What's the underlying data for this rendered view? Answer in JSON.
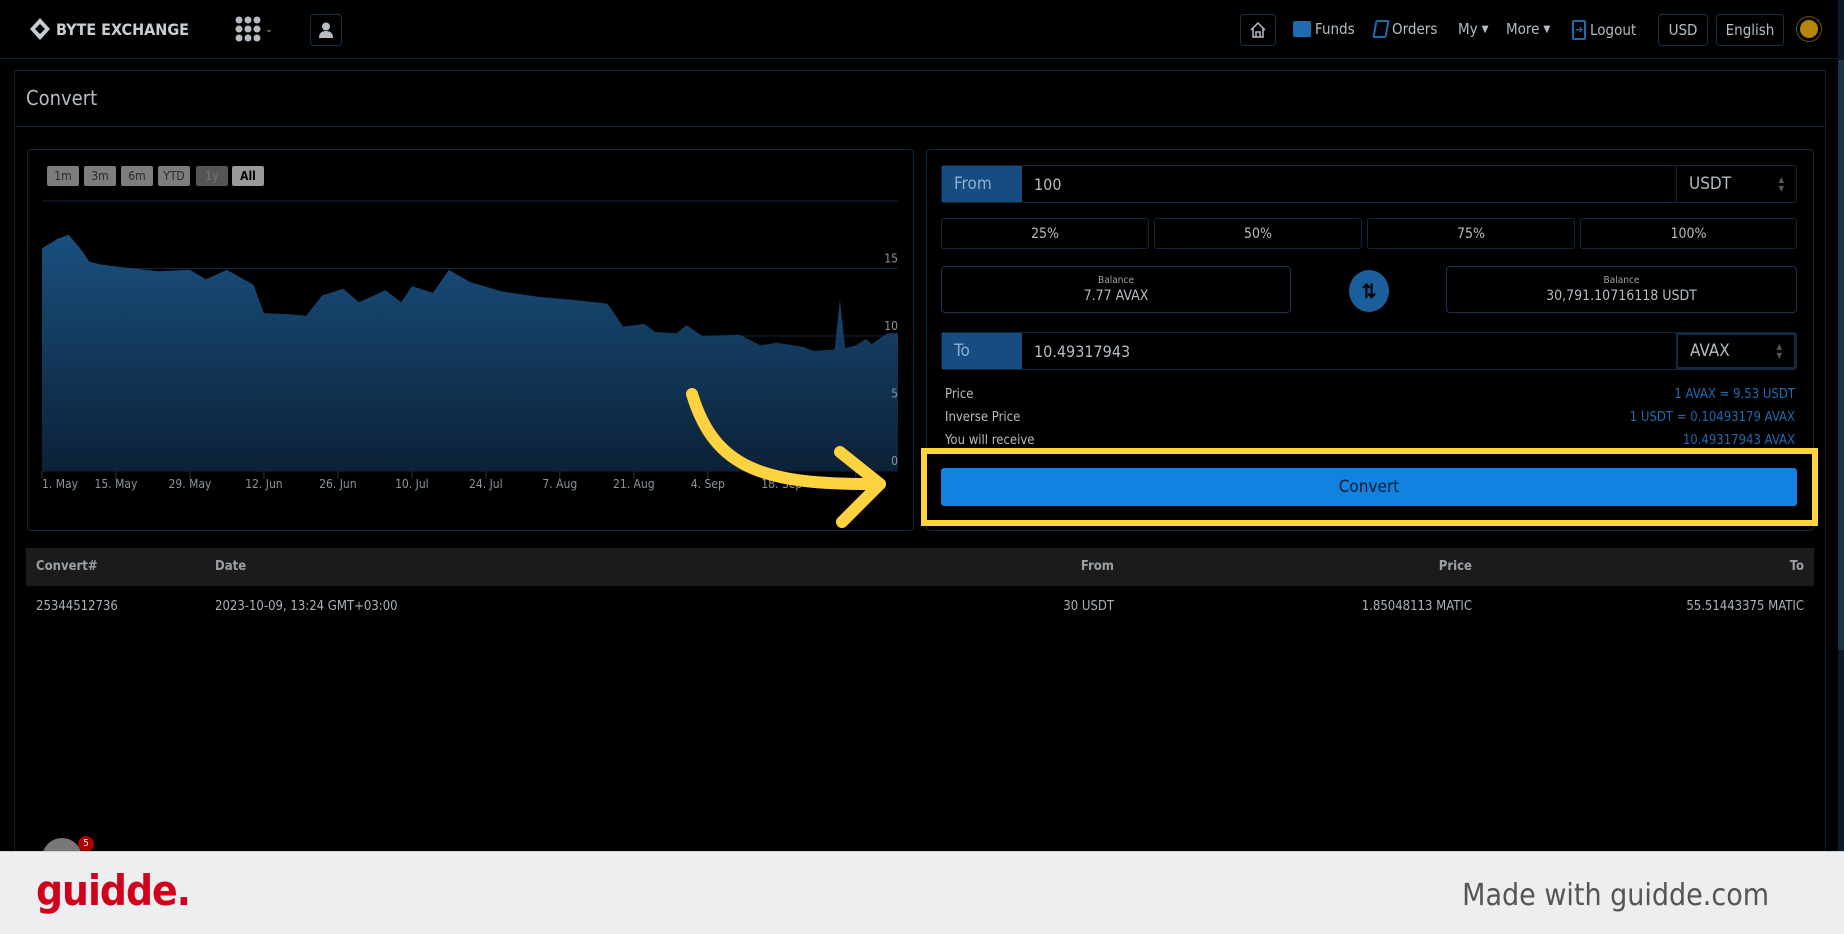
{
  "nav": {
    "brand": "BYTE EXCHANGE",
    "links": {
      "funds": "Funds",
      "orders": "Orders",
      "my": "My",
      "more": "More",
      "logout": "Logout"
    },
    "currency": "USD",
    "language": "English"
  },
  "page": {
    "title": "Convert"
  },
  "chart_controls": {
    "ranges": [
      "1m",
      "3m",
      "6m",
      "YTD",
      "1y",
      "All"
    ],
    "active": "All",
    "disabled": "1y"
  },
  "chart_data": {
    "type": "area",
    "title": "",
    "xlabel": "",
    "ylabel": "",
    "x": [
      "2023-05-01",
      "2023-05-04",
      "2023-05-06",
      "2023-05-08",
      "2023-05-10",
      "2023-05-12",
      "2023-05-16",
      "2023-05-23",
      "2023-05-29",
      "2023-06-01",
      "2023-06-05",
      "2023-06-10",
      "2023-06-12",
      "2023-06-17",
      "2023-06-20",
      "2023-06-23",
      "2023-06-27",
      "2023-06-30",
      "2023-07-05",
      "2023-07-08",
      "2023-07-10",
      "2023-07-14",
      "2023-07-17",
      "2023-07-21",
      "2023-07-27",
      "2023-08-03",
      "2023-08-09",
      "2023-08-16",
      "2023-08-19",
      "2023-08-23",
      "2023-08-25",
      "2023-08-29",
      "2023-08-31",
      "2023-09-03",
      "2023-09-10",
      "2023-09-14",
      "2023-09-17",
      "2023-09-22",
      "2023-09-24",
      "2023-09-28",
      "2023-09-29",
      "2023-09-30",
      "2023-10-02",
      "2023-10-04",
      "2023-10-05",
      "2023-10-08",
      "2023-10-10"
    ],
    "values": [
      16.5,
      17.2,
      17.5,
      16.6,
      15.5,
      15.3,
      15.1,
      14.8,
      14.9,
      14.2,
      14.9,
      13.8,
      11.7,
      11.6,
      11.5,
      13.0,
      13.5,
      12.5,
      13.4,
      12.5,
      13.7,
      13.2,
      14.9,
      14.0,
      13.3,
      12.9,
      12.7,
      12.4,
      10.7,
      10.9,
      10.3,
      10.2,
      10.8,
      10.0,
      10.1,
      9.3,
      9.5,
      9.2,
      8.9,
      9.0,
      12.7,
      9.1,
      9.3,
      9.8,
      9.4,
      10.2,
      10.2
    ],
    "x_ticks": [
      "1. May",
      "15. May",
      "29. May",
      "12. Jun",
      "26. Jun",
      "10. Jul",
      "24. Jul",
      "7. Aug",
      "21. Aug",
      "4. Sep",
      "18. Sep",
      "2. Oct"
    ],
    "y_ticks": [
      0,
      5,
      10,
      15
    ],
    "ylim": [
      0,
      20
    ],
    "grid": true,
    "color": "#1a4f80"
  },
  "convert": {
    "from_label": "From",
    "from_value": "100",
    "from_currency": "USDT",
    "percents": [
      "25%",
      "50%",
      "75%",
      "100%"
    ],
    "balance_label": "Balance",
    "balance_left": "7.77 AVAX",
    "balance_right": "30,791.10716118 USDT",
    "to_label": "To",
    "to_value": "10.49317943",
    "to_currency": "AVAX",
    "price_label": "Price",
    "price_value": "1 AVAX = 9.53 USDT",
    "inverse_label": "Inverse Price",
    "inverse_value": "1 USDT = 0.10493179 AVAX",
    "receive_label": "You will receive",
    "receive_value": "10.49317943 AVAX",
    "button": "Convert"
  },
  "table": {
    "headers": [
      "Convert#",
      "Date",
      "From",
      "Price",
      "To"
    ],
    "rows": [
      [
        "25344512736",
        "2023-10-09, 13:24 GMT+03:00",
        "30 USDT",
        "1.85048113 MATIC",
        "55.51443375 MATIC"
      ]
    ]
  },
  "widget_badge": "5",
  "footer": {
    "logo": "guidde.",
    "tagline": "Made with guidde.com"
  },
  "colors": {
    "accent": "#1282e0",
    "label_bg": "#164c80",
    "highlight": "#ffd23f",
    "brand_red": "#d0021b"
  }
}
